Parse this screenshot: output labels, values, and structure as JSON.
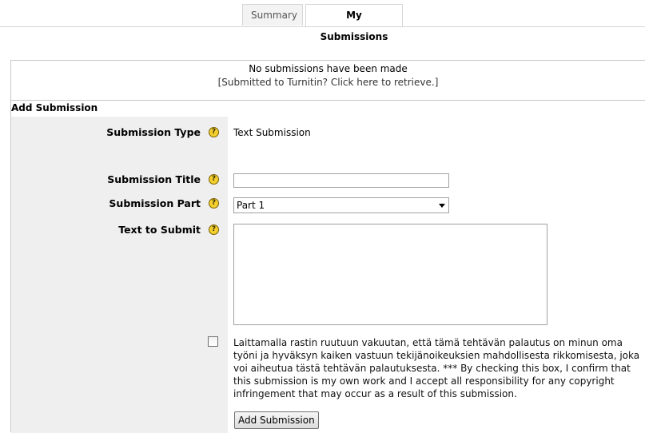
{
  "tabs": [
    {
      "label": "Summary",
      "active": false
    },
    {
      "label": "My Submissions",
      "active": true
    }
  ],
  "status": {
    "message": "No submissions have been made",
    "retrieve_link": "[Submitted to Turnitin? Click here to retrieve.]"
  },
  "form": {
    "heading": "Add Submission",
    "help_glyph": "?",
    "submission_type": {
      "label": "Submission Type",
      "value": "Text Submission"
    },
    "submission_title": {
      "label": "Submission Title",
      "value": ""
    },
    "submission_part": {
      "label": "Submission Part",
      "selected": "Part 1"
    },
    "text_to_submit": {
      "label": "Text to Submit",
      "value": ""
    },
    "agreement_checked": false,
    "agreement_text": "Laittamalla rastin ruutuun vakuutan, että tämä tehtävän palautus on minun oma työni ja hyväksyn kaiken vastuun tekijänoikeuksien mahdollisesta rikkomisesta, joka voi aiheutua tästä tehtävän palautuksesta. *** By checking this box, I confirm that this submission is my own work and I accept all responsibility for any copyright infringement that may occur as a result of this submission.",
    "submit_label": "Add Submission"
  },
  "colors": {
    "help_icon": "#f2cf2e",
    "label_column": "#efefef",
    "border": "#c8c8c8"
  }
}
